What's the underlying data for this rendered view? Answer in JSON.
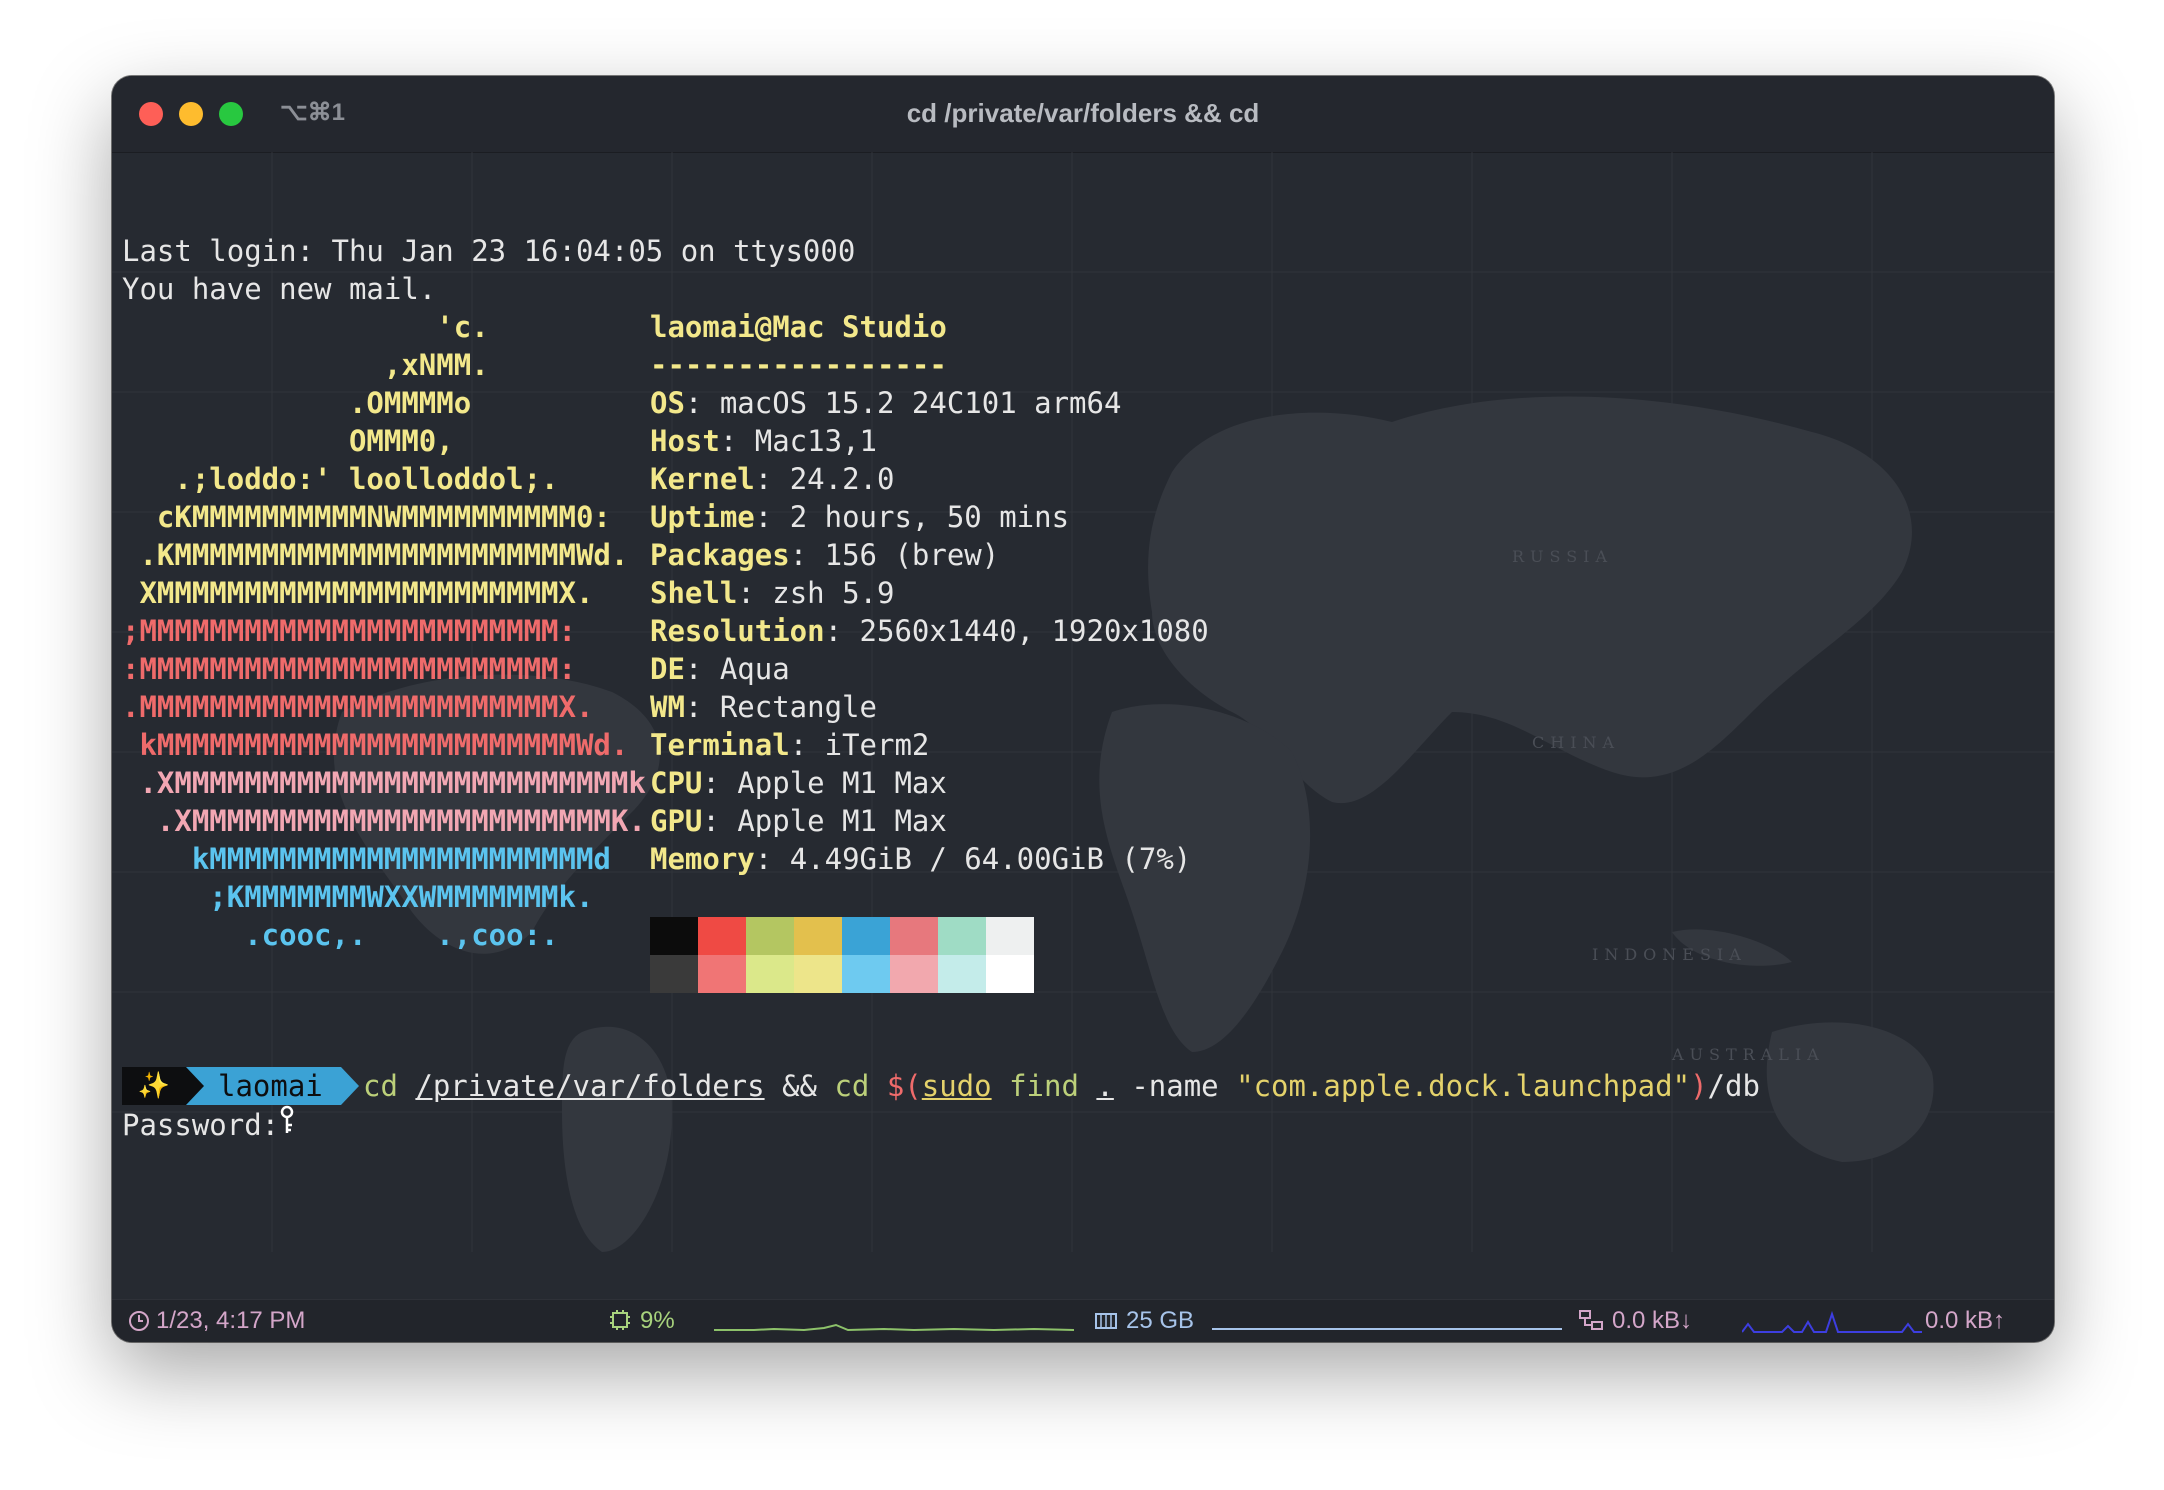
{
  "window": {
    "shortcut": "⌥⌘1",
    "title": "cd /private/var/folders && cd"
  },
  "terminal": {
    "last_login": "Last login: Thu Jan 23 16:04:05 on ttys000",
    "mail": "You have new mail.",
    "ascii_art": [
      {
        "text": "                  'c.",
        "color": "#f3e88b"
      },
      {
        "text": "               ,xNMM.",
        "color": "#f3e88b"
      },
      {
        "text": "             .OMMMMo",
        "color": "#f3e88b"
      },
      {
        "text": "             OMMM0,",
        "color": "#f3e88b"
      },
      {
        "text": "   .;loddo:' loolloddol;.",
        "color": "#f3e88b"
      },
      {
        "text": "  cKMMMMMMMMMMNWMMMMMMMMMM0:",
        "color": "#f3e88b"
      },
      {
        "text": " .KMMMMMMMMMMMMMMMMMMMMMMMWd.",
        "color": "#f3e88b"
      },
      {
        "text": " XMMMMMMMMMMMMMMMMMMMMMMMX.",
        "color": "#f3e88b"
      },
      {
        "text": ";MMMMMMMMMMMMMMMMMMMMMMMM:",
        "color": "#ef6b6b"
      },
      {
        "text": ":MMMMMMMMMMMMMMMMMMMMMMMM:",
        "color": "#ef6b6b"
      },
      {
        "text": ".MMMMMMMMMMMMMMMMMMMMMMMMX.",
        "color": "#ef6b6b"
      },
      {
        "text": " kMMMMMMMMMMMMMMMMMMMMMMMMWd.",
        "color": "#ef6b6b"
      },
      {
        "text": " .XMMMMMMMMMMMMMMMMMMMMMMMMMMk",
        "color": "#f2a7b3"
      },
      {
        "text": "  .XMMMMMMMMMMMMMMMMMMMMMMMMK.",
        "color": "#f2a7b3"
      },
      {
        "text": "    kMMMMMMMMMMMMMMMMMMMMMMd",
        "color": "#5bc4ef"
      },
      {
        "text": "     ;KMMMMMMMWXXWMMMMMMMk.",
        "color": "#5bc4ef"
      },
      {
        "text": "       .cooc,.    .,coo:.",
        "color": "#5bc4ef"
      }
    ],
    "user_host": "laomai@Mac Studio",
    "separator": "-----------------",
    "info": [
      {
        "key": "OS",
        "value": "macOS 15.2 24C101 arm64"
      },
      {
        "key": "Host",
        "value": "Mac13,1"
      },
      {
        "key": "Kernel",
        "value": "24.2.0"
      },
      {
        "key": "Uptime",
        "value": "2 hours, 50 mins"
      },
      {
        "key": "Packages",
        "value": "156 (brew)"
      },
      {
        "key": "Shell",
        "value": "zsh 5.9"
      },
      {
        "key": "Resolution",
        "value": "2560x1440, 1920x1080"
      },
      {
        "key": "DE",
        "value": "Aqua"
      },
      {
        "key": "WM",
        "value": "Rectangle"
      },
      {
        "key": "Terminal",
        "value": "iTerm2"
      },
      {
        "key": "CPU",
        "value": "Apple M1 Max"
      },
      {
        "key": "GPU",
        "value": "Apple M1 Max"
      },
      {
        "key": "Memory",
        "value": "4.49GiB / 64.00GiB (7%)"
      }
    ],
    "palette_top": [
      "#0c0c0c",
      "#ef4a44",
      "#b4c661",
      "#e3c04d",
      "#3aa3d6",
      "#e7787d",
      "#9fdcc5",
      "#eef0f0"
    ],
    "palette_bottom": [
      "#3a3a3a",
      "#f07575",
      "#dbe88a",
      "#ede58a",
      "#6ecaf0",
      "#f2a8ae",
      "#c4ecea",
      "#ffffff"
    ],
    "prompt": {
      "sparkle_icon": "✨",
      "user": "laomai"
    },
    "command": {
      "cd1": "cd",
      "path": "/private/var/folders",
      "and": "&&",
      "cd2": "cd",
      "sub_open": "$(",
      "sudo": "sudo",
      "find": "find",
      "dot": ".",
      "flag": "-name",
      "pattern": "\"com.apple.dock.launchpad\"",
      "sub_close": ")",
      "tail": "/db"
    },
    "password_label": "Password:",
    "cursor_icon": "key-icon"
  },
  "statusbar": {
    "time": "1/23, 4:17 PM",
    "cpu": "9%",
    "disk": "25 GB",
    "net_down": "0.0 kB↓",
    "net_up": "0.0 kB↑"
  }
}
